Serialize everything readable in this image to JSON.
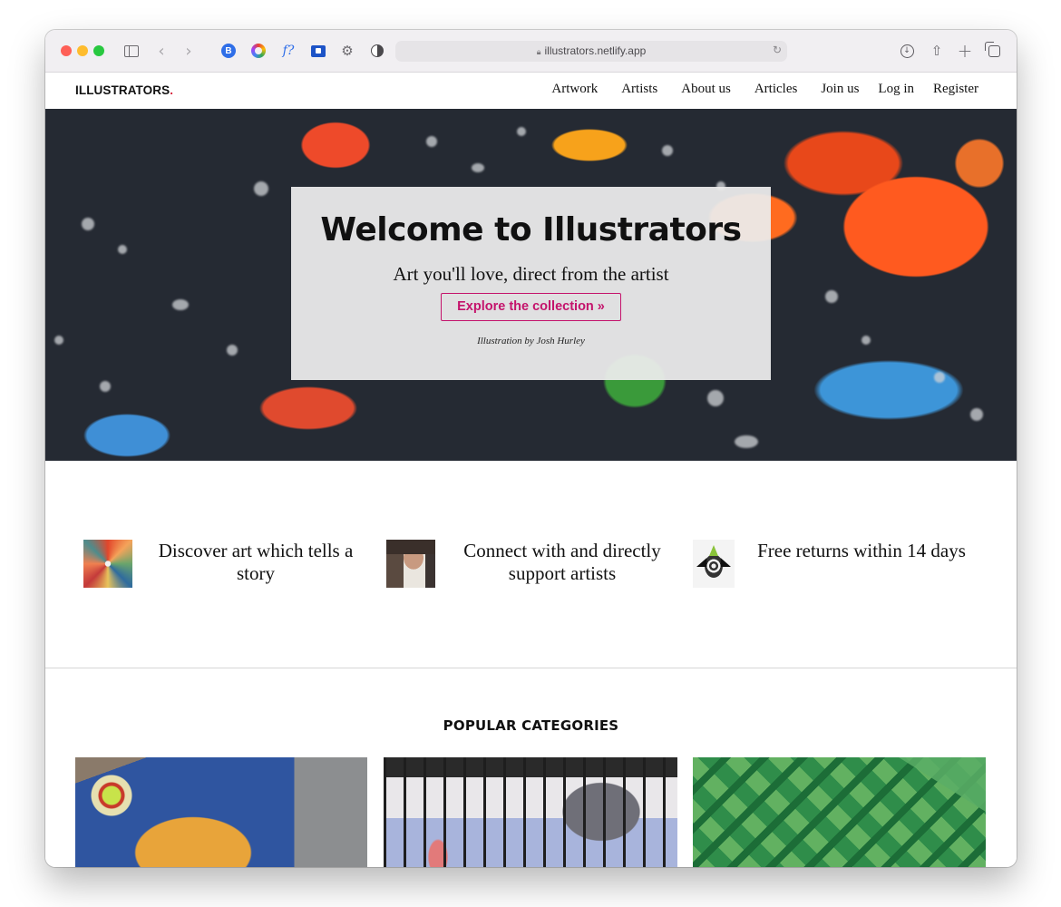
{
  "browser": {
    "url": "illustrators.netlify.app",
    "extensions": [
      "bitwarden-icon",
      "color-picker-icon",
      "font-identifier-icon",
      "screenshot-extension-icon",
      "settings-gear-icon",
      "privacy-shield-icon"
    ],
    "ext3_label": "f?"
  },
  "site": {
    "logo": "ILLUSTRATORS",
    "logo_dot": ".",
    "logo_dot_color": "#d7263d",
    "nav": [
      "Artwork",
      "Artists",
      "About us",
      "Articles",
      "Join us",
      "Log in",
      "Register"
    ],
    "accent_color": "#c4136c"
  },
  "hero": {
    "title": "Welcome to Illustrators",
    "subtitle": "Art you'll love, direct from the artist",
    "button": "Explore the collection »",
    "credit": "Illustration by Josh Hurley"
  },
  "features": [
    {
      "text": "Discover art which tells a story",
      "icon": "art-thumbnail"
    },
    {
      "text": "Connect with and directly support artists",
      "icon": "artist-photo-thumbnail"
    },
    {
      "text": "Free returns within 14 days",
      "icon": "pineapple-bat-thumbnail"
    }
  ],
  "categories": {
    "heading": "POPULAR CATEGORIES",
    "items": [
      "category-illustration-car",
      "category-illustration-raccoons",
      "category-illustration-trees"
    ]
  }
}
